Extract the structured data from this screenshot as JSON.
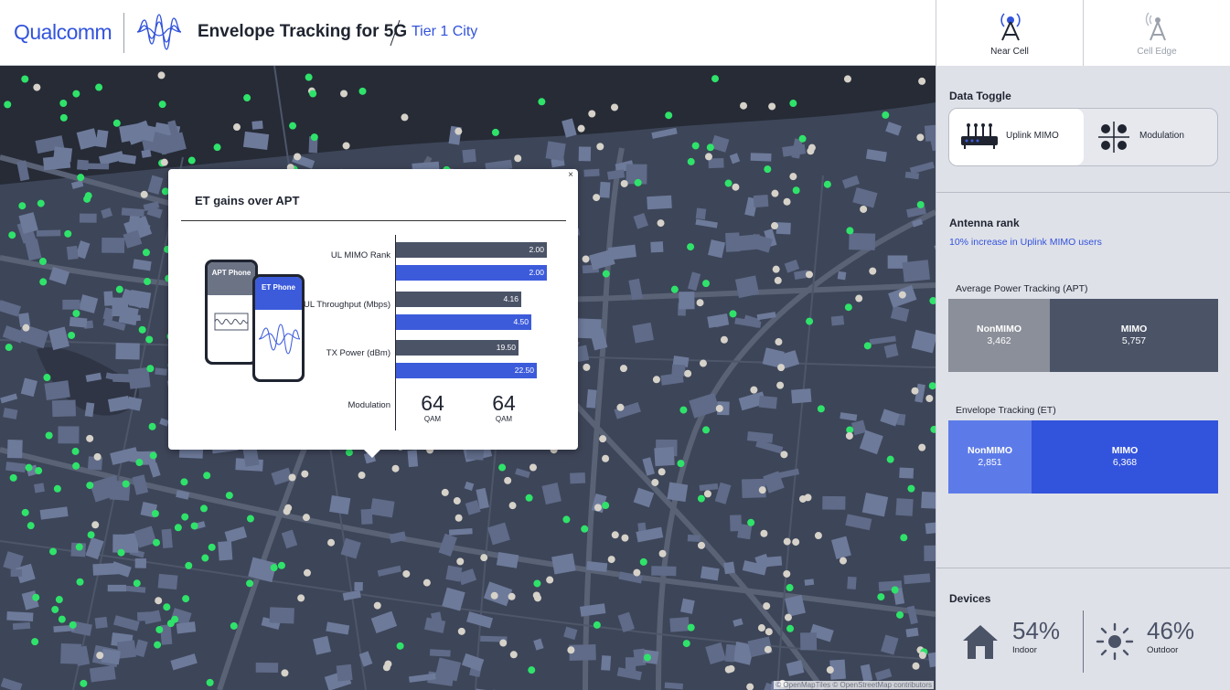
{
  "header": {
    "brand": "Qualcomm",
    "title": "Envelope Tracking for 5G",
    "location": "Tier 1 City",
    "tabs": [
      {
        "label": "Near Cell",
        "active": true
      },
      {
        "label": "Cell Edge",
        "active": false
      }
    ]
  },
  "map": {
    "attribution": "© OpenMapTiles © OpenStreetMap contributors",
    "marker_colors": {
      "mimo": "#2fe36a",
      "non_mimo": "#d6d2c9"
    }
  },
  "popup": {
    "close": "×",
    "title": "ET gains over APT",
    "phones": {
      "apt_label": "APT Phone",
      "et_label": "ET Phone"
    },
    "rows": [
      {
        "label": "UL MIMO Rank",
        "apt": "2.00",
        "et": "2.00"
      },
      {
        "label": "UL Throughput (Mbps)",
        "apt": "4.16",
        "et": "4.50"
      },
      {
        "label": "TX Power (dBm)",
        "apt": "19.50",
        "et": "22.50"
      }
    ],
    "modulation": {
      "label": "Modulation",
      "apt_value": "64",
      "apt_unit": "QAM",
      "et_value": "64",
      "et_unit": "QAM"
    }
  },
  "panel": {
    "data_toggle": {
      "title": "Data Toggle",
      "options": [
        {
          "label": "Uplink MIMO",
          "active": true
        },
        {
          "label": "Modulation",
          "active": false
        }
      ]
    },
    "antenna": {
      "title": "Antenna rank",
      "subtitle": "10% increase in Uplink MIMO users",
      "apt": {
        "title": "Average Power Tracking (APT)",
        "non_mimo_label": "NonMIMO",
        "non_mimo_value": "3,462",
        "mimo_label": "MIMO",
        "mimo_value": "5,757"
      },
      "et": {
        "title": "Envelope Tracking (ET)",
        "non_mimo_label": "NonMIMO",
        "non_mimo_value": "2,851",
        "mimo_label": "MIMO",
        "mimo_value": "6,368"
      }
    },
    "devices": {
      "title": "Devices",
      "indoor_pct": "54%",
      "indoor_label": "Indoor",
      "outdoor_pct": "46%",
      "outdoor_label": "Outdoor"
    }
  },
  "colors": {
    "accent": "#3253DC",
    "apt_bar": "#4b5367",
    "et_bar": "#3c5bdb",
    "apt_nonmimo": "#8b8f99",
    "apt_mimo": "#4b5367",
    "et_nonmimo": "#5d7be8",
    "et_mimo": "#3253DC"
  }
}
